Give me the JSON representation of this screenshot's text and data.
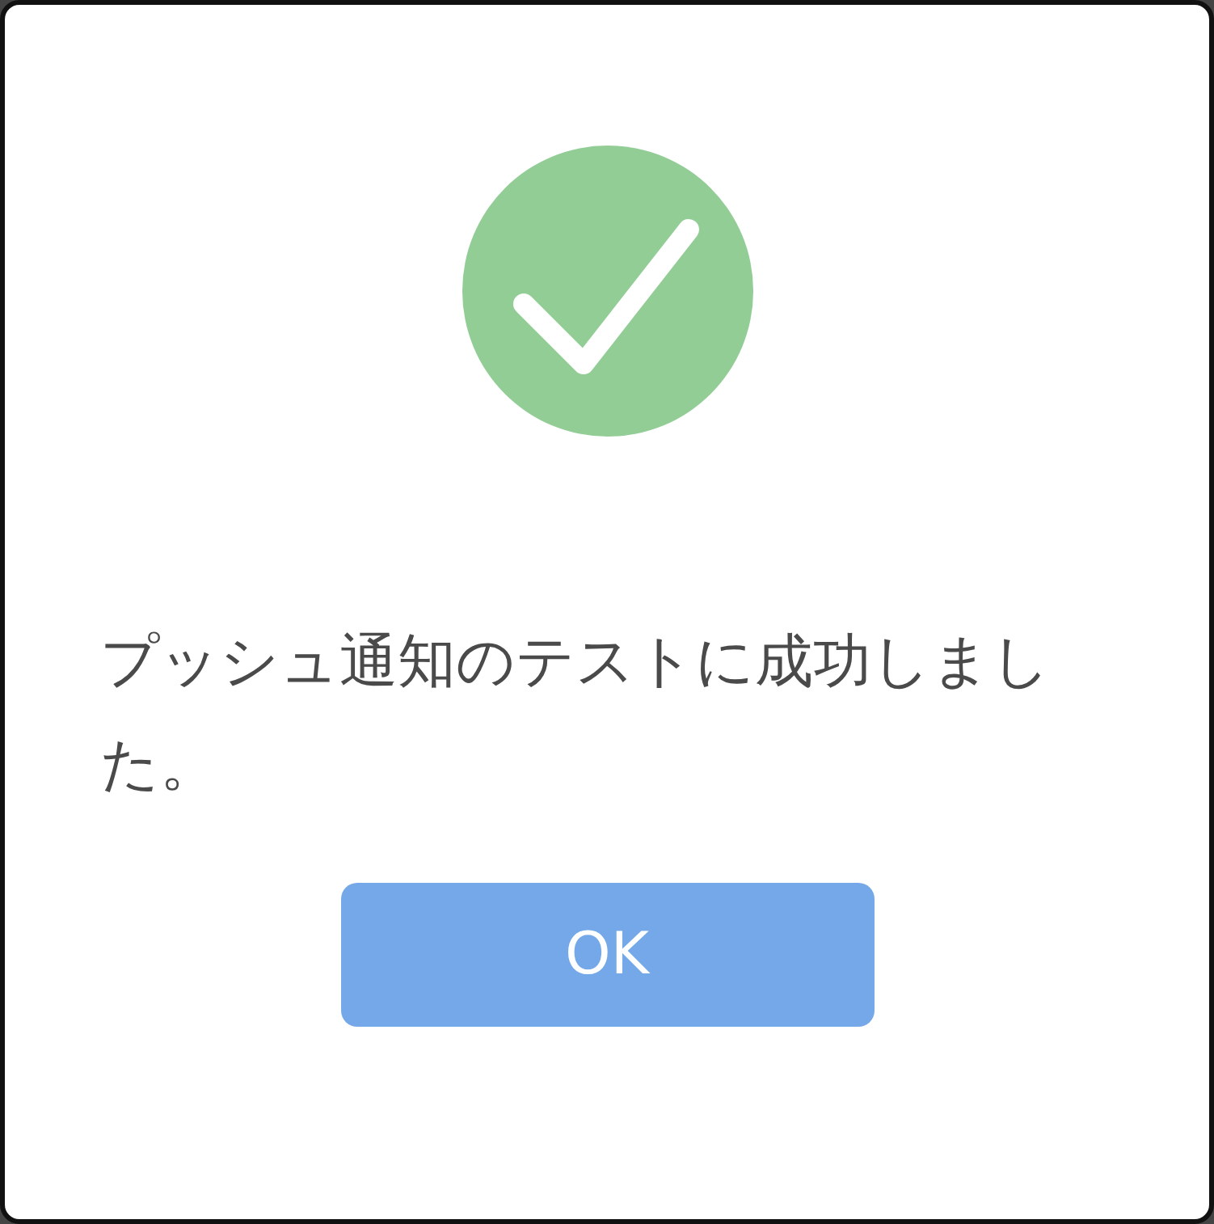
{
  "dialog": {
    "message": "プッシュ通知のテストに成功しました。",
    "buttons": [
      "OK"
    ]
  }
}
